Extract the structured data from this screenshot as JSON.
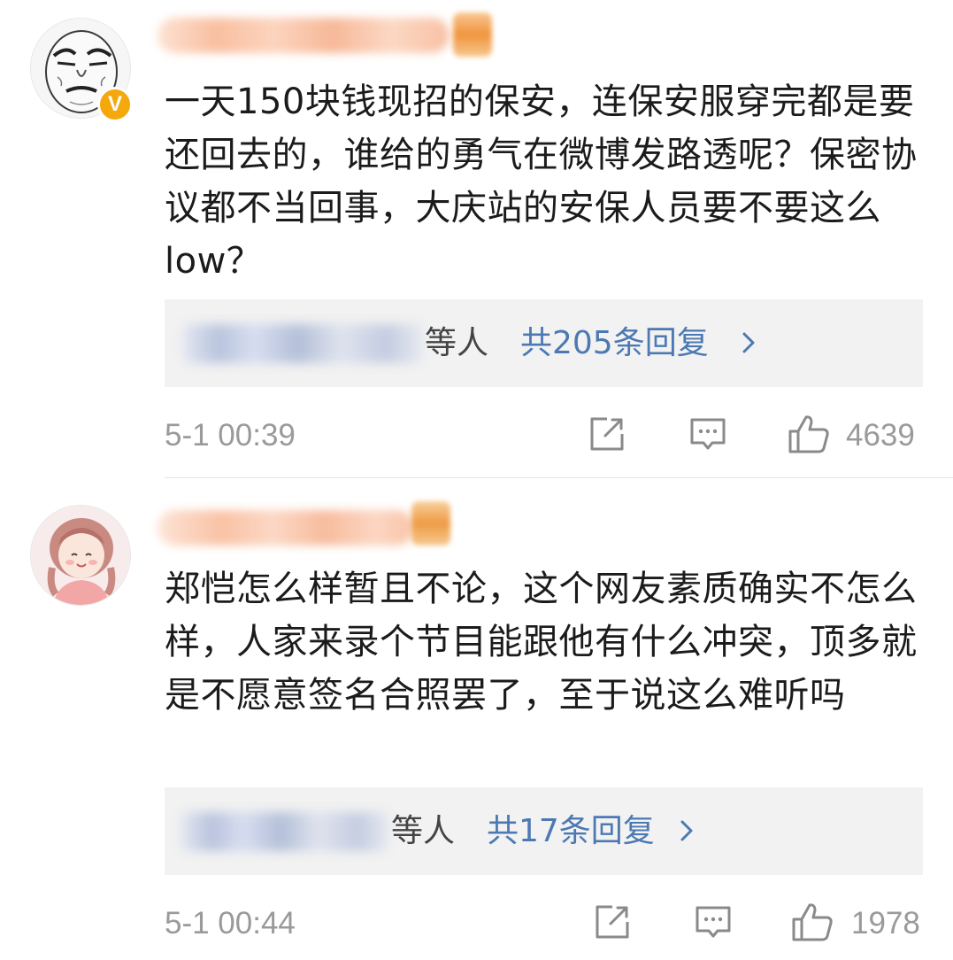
{
  "comments": [
    {
      "verified_badge": "V",
      "text": "一天150块钱现招的保安，连保安服穿完都是要还回去的，谁给的勇气在微博发路透呢？保密协议都不当回事，大庆站的安保人员要不要这么low？",
      "reply_suffix": "等人",
      "reply_count_label": "共205条回复",
      "timestamp": "5-1 00:39",
      "likes": "4639"
    },
    {
      "text": "郑恺怎么样暂且不论，这个网友素质确实不怎么样，人家来录个节目能跟他有什么冲突，顶多就是不愿意签名合照罢了，至于说这么难听吗",
      "reply_suffix": "等人",
      "reply_count_label": "共17条回复",
      "timestamp": "5-1 00:44",
      "likes": "1978"
    }
  ],
  "icons": {
    "share": "share-icon",
    "comment": "comment-icon",
    "like": "thumbs-up-icon",
    "chevron": "chevron-right-icon"
  },
  "colors": {
    "link_blue": "#4d79b3",
    "meta_gray": "#9a9a9a",
    "reply_bg": "#f2f2f2",
    "verified_gold": "#f5a80b"
  }
}
